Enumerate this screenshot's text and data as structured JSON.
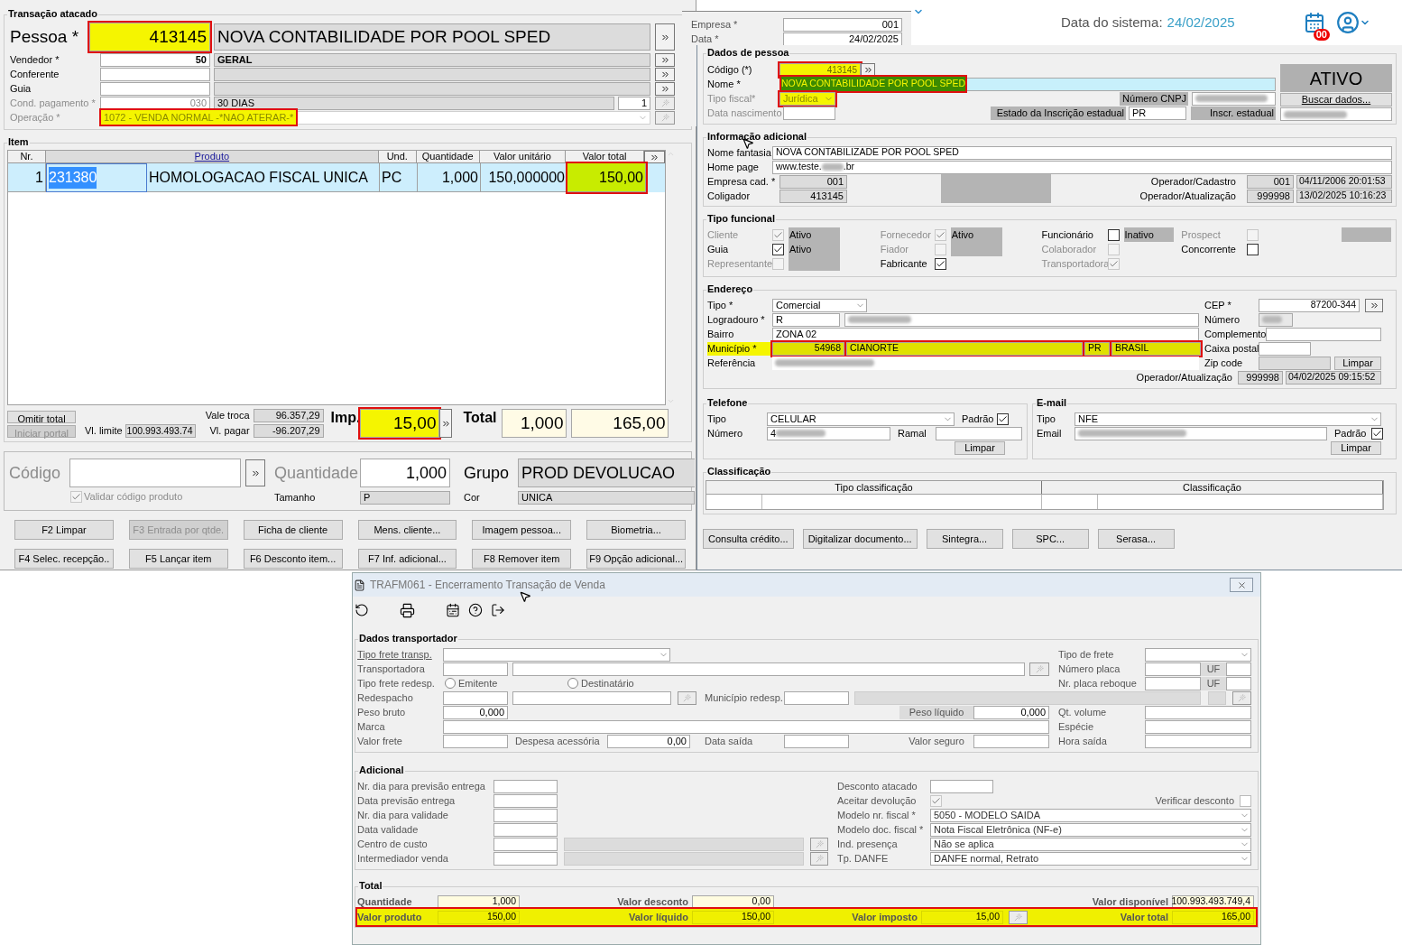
{
  "main": {
    "title": "Transação atacado",
    "pessoa": {
      "label": "Pessoa *",
      "code": "413145",
      "name": "NOVA CONTABILIDADE POR POOL SPED",
      "highlighted": true
    },
    "lookups": [
      {
        "label": "Vendedor *",
        "code": "50",
        "name": "GERAL"
      },
      {
        "label": "Conferente"
      },
      {
        "label": "Guia"
      }
    ],
    "cond": {
      "label": "Cond. pagamento *",
      "code": "030",
      "name": "30 DIAS",
      "installments": "1"
    },
    "operacao": {
      "label": "Operação *",
      "value": "1072 - VENDA NORMAL -*NAO ATERAR-*",
      "highlighted": true
    },
    "item": {
      "title": "Item",
      "columns": [
        "Nr.",
        "Produto",
        "Und.",
        "Quantidade",
        "Valor unitário",
        "Valor total"
      ],
      "rows": [
        {
          "nr": "1",
          "product": {
            "code": "231380",
            "description": "HOMOLOGACAO FISCAL UNICA"
          },
          "unit": "PC",
          "quantity": "1,000",
          "unit_price": "150,000000",
          "total": "150,00",
          "selected": true,
          "total_highlighted": true
        }
      ]
    },
    "summary": {
      "buttons": [
        {
          "label": "Omitir total",
          "disabled": false
        },
        {
          "label": "Iniciar portal",
          "disabled": true
        }
      ],
      "limit": {
        "label": "Vl. limite",
        "value": "100.993.493.74"
      },
      "exchange": {
        "label": "Vale troca",
        "value": "96.357,29"
      },
      "to_pay": {
        "label": "Vl. pagar",
        "value": "-96.207,29"
      },
      "tax": {
        "label": "Imp.",
        "value": "15,00",
        "highlighted": true
      },
      "total": {
        "label": "Total",
        "quantity": "1,000",
        "value": "165,00"
      }
    },
    "entry": {
      "code_label": "Código",
      "validate": {
        "label": "Validar código produto",
        "checked": true,
        "disabled": true
      },
      "qty_label": "Quantidade",
      "qty": "1,000",
      "size_label": "Tamanho",
      "size": "P",
      "group_label": "Grupo",
      "group": "PROD DEVOLUCAO",
      "color_label": "Cor",
      "color_value": "UNICA"
    },
    "buttons": [
      {
        "label": "F2 Limpar",
        "disabled": false
      },
      {
        "label": "F3 Entrada por qtde.",
        "disabled": true
      },
      {
        "label": "Ficha de cliente",
        "disabled": false
      },
      {
        "label": "Mens. cliente...",
        "disabled": false
      },
      {
        "label": "Imagem pessoa...",
        "disabled": false
      },
      {
        "label": "Biometria...",
        "disabled": false
      },
      {
        "label": "F4 Selec. recepção..",
        "disabled": false
      },
      {
        "label": "F5 Lançar item",
        "disabled": false
      },
      {
        "label": "F6 Desconto item...",
        "disabled": false
      },
      {
        "label": "F7 Inf. adicional...",
        "disabled": false
      },
      {
        "label": "F8 Remover item",
        "disabled": false
      },
      {
        "label": "F9 Opção adicional...",
        "disabled": false
      }
    ]
  },
  "back_window": {
    "fields": [
      {
        "label": "Empresa *",
        "value": "001"
      },
      {
        "label": "Data *",
        "value": "24/02/2025"
      }
    ]
  },
  "system": {
    "label": "Data do sistema:",
    "date": "24/02/2025",
    "badge": "00"
  },
  "person": {
    "data": {
      "title": "Dados de pessoa",
      "code": {
        "label": "Código (*)",
        "value": "413145",
        "highlighted": true
      },
      "name": {
        "label": "Nome *",
        "value": "NOVA CONTABILIDADE POR POOL SPED",
        "highlighted": true
      },
      "fiscal_type": {
        "label": "Tipo fiscal*",
        "value": "Jurídica",
        "highlighted": true
      },
      "birth": {
        "label": "Data nascimento"
      },
      "status": "ATIVO",
      "cnpj_label": "Número CNPJ",
      "fetch_button": "Buscar dados...",
      "state_label": "Estado da Inscrição estadual",
      "state": "PR",
      "ie_label": "Inscr. estadual"
    },
    "info": {
      "title": "Informação adicional",
      "trade_name": {
        "label": "Nome fantasia",
        "value": "NOVA CONTABILIZADE POR POOL SPED"
      },
      "home_page": {
        "label": "Home page",
        "prefix": "www.teste.",
        "suffix": ".br"
      },
      "company": {
        "label": "Empresa cad. *",
        "value": "001"
      },
      "group": {
        "label": "Coligador",
        "value": "413145"
      },
      "created": {
        "label": "Operador/Cadastro",
        "operator": "001",
        "date": "04/11/2006 20:01:53"
      },
      "updated": {
        "label": "Operador/Atualização",
        "operator": "999998",
        "date": "13/02/2025 10:16:23"
      }
    },
    "roles": {
      "title": "Tipo funcional",
      "columns": [
        [
          {
            "label": "Cliente",
            "checked": true,
            "disabled": true,
            "kind": "status",
            "status": "Ativo"
          },
          {
            "label": "Guia",
            "checked": true,
            "disabled": false,
            "kind": "status",
            "status": "Ativo"
          },
          {
            "label": "Representante",
            "checked": false,
            "disabled": true,
            "kind": "status"
          }
        ],
        [
          {
            "label": "Fornecedor",
            "checked": true,
            "disabled": true,
            "kind": "status",
            "status": "Ativo"
          },
          {
            "label": "Fiador",
            "checked": false,
            "disabled": true,
            "kind": "status"
          },
          {
            "label": "Fabricante",
            "checked": true,
            "disabled": false,
            "kind": "plain"
          }
        ],
        [
          {
            "label": "Funcionário",
            "checked": false,
            "disabled": false,
            "kind": "status",
            "status": "Inativo"
          },
          {
            "label": "Colaborador",
            "checked": false,
            "disabled": true,
            "kind": "plain"
          },
          {
            "label": "Transportadora",
            "checked": true,
            "disabled": true,
            "kind": "plain"
          }
        ],
        [
          {
            "label": "Prospect",
            "checked": false,
            "disabled": true,
            "kind": "status"
          },
          {
            "label": "Concorrente",
            "checked": false,
            "disabled": false,
            "kind": "plain"
          }
        ]
      ]
    },
    "address": {
      "title": "Endereço",
      "type": {
        "label": "Tipo *",
        "value": "Comercial"
      },
      "street": {
        "label": "Logradouro *",
        "value": "R"
      },
      "district": {
        "label": "Bairro",
        "value": "ZONA 02"
      },
      "city": {
        "label": "Município *",
        "code": "54968",
        "name": "CIANORTE",
        "uf": "PR",
        "country": "BRASIL",
        "highlighted": true
      },
      "reference": {
        "label": "Referência"
      },
      "cep": {
        "label": "CEP *",
        "value": "87200-344"
      },
      "number": {
        "label": "Número"
      },
      "complement": {
        "label": "Complemento"
      },
      "po_box": {
        "label": "Caixa postal"
      },
      "zip": {
        "label": "Zip code"
      },
      "clear": "Limpar",
      "updated": {
        "label": "Operador/Atualização",
        "operator": "999998",
        "date": "04/02/2025 09:15:52"
      }
    },
    "phone": {
      "title": "Telefone",
      "type_label": "Tipo",
      "type": "CELULAR",
      "default_label": "Padrão",
      "default": true,
      "number_label": "Número",
      "number": "4",
      "ext_label": "Ramal",
      "clear": "Limpar"
    },
    "email": {
      "title": "E-mail",
      "type_label": "Tipo",
      "type": "NFE",
      "email_label": "Email",
      "default_label": "Padrão",
      "default": true,
      "clear": "Limpar"
    },
    "classification": {
      "title": "Classificação",
      "columns": [
        "Tipo classificação",
        "Classificação"
      ]
    },
    "buttons": [
      "Consulta crédito...",
      "Digitalizar documento...",
      "Sintegra...",
      "SPC...",
      "Serasa..."
    ]
  },
  "closing": {
    "title": "TRAFM061 - Encerramento Transação de Venda",
    "transport": {
      "title": "Dados transportador",
      "freight_type": "Tipo frete transp.",
      "carrier": "Transportadora",
      "redesp_type": "Tipo frete redesp.",
      "redesp_options": [
        {
          "label": "Emitente",
          "selected": false
        },
        {
          "label": "Destinatário",
          "selected": false
        }
      ],
      "redespacho": "Redespacho",
      "city_redesp": "Município redesp.",
      "gross_weight": {
        "label": "Peso bruto",
        "value": "0,000"
      },
      "net_weight": {
        "label": "Peso líquido",
        "value": "0,000"
      },
      "brand": "Marca",
      "freight_value": "Valor frete",
      "extra_cost": {
        "label": "Despesa acessória",
        "value": "0,00"
      },
      "ship_date": "Data saída",
      "insurance": "Valor seguro",
      "freight_kind": "Tipo de frete",
      "plate": {
        "label": "Número placa",
        "uf": "UF"
      },
      "trailer": {
        "label": "Nr. placa reboque",
        "uf": "UF"
      },
      "volume": "Qt. volume",
      "species": "Espécie",
      "ship_time": "Hora saída"
    },
    "additional": {
      "title": "Adicional",
      "left": [
        "Nr. dia para previsão entrega",
        "Data previsão entrega",
        "Nr. dia para validade",
        "Data validade",
        "Centro de custo",
        "Intermediador venda"
      ],
      "wholesale_discount": "Desconto atacado",
      "accept_return": {
        "label": "Aceitar devolução",
        "checked": true,
        "disabled": true
      },
      "check_discount": {
        "label": "Verificar desconto",
        "checked": false
      },
      "combos": [
        {
          "label": "Modelo nr. fiscal *",
          "value": "5050 - MODELO SAIDA"
        },
        {
          "label": "Modelo doc. fiscal *",
          "value": "Nota Fiscal Eletrônica (NF-e)"
        },
        {
          "label": "Ind. presença",
          "value": "Não se aplica"
        },
        {
          "label": "Tp. DANFE",
          "value": "DANFE normal, Retrato"
        }
      ]
    },
    "totals": {
      "title": "Total",
      "rows": [
        {
          "highlighted": false,
          "cells": [
            {
              "kind": "value",
              "label": "Quantidade",
              "value": "1,000"
            },
            {
              "kind": "value",
              "label": "Valor desconto",
              "value": "0,00"
            },
            {
              "kind": "blank"
            },
            {
              "kind": "value",
              "label": "Valor disponível",
              "value": "100.993.493.749,4"
            }
          ]
        },
        {
          "highlighted": true,
          "cells": [
            {
              "kind": "value",
              "label": "Valor produto",
              "value": "150,00"
            },
            {
              "kind": "value",
              "label": "Valor líquido",
              "value": "150,00"
            },
            {
              "kind": "value_button",
              "label": "Valor imposto",
              "value": "15,00"
            },
            {
              "kind": "value",
              "label": "Valor total",
              "value": "165,00"
            }
          ]
        }
      ]
    }
  }
}
